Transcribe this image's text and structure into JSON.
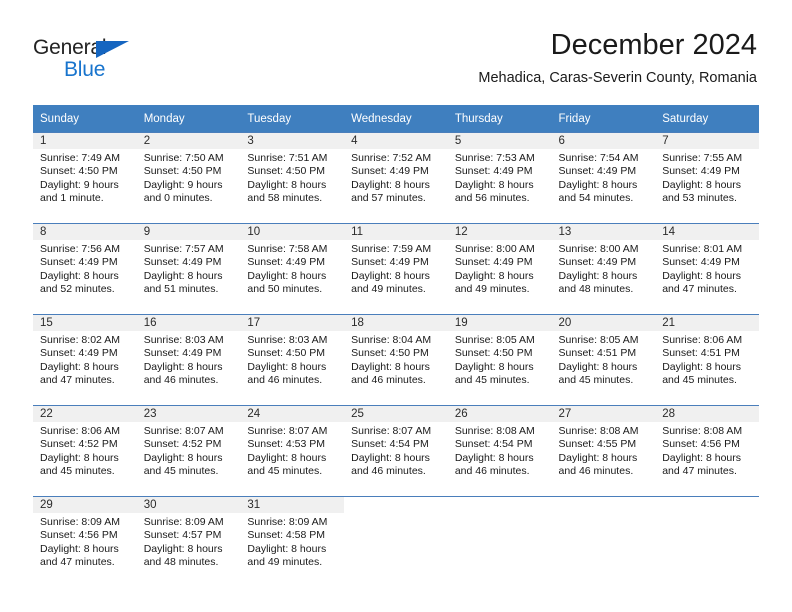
{
  "brand": {
    "name_part1": "General",
    "name_part2": "Blue",
    "accent_color": "#1874cd"
  },
  "header": {
    "title": "December 2024",
    "subtitle": "Mehadica, Caras-Severin County, Romania"
  },
  "calendar": {
    "header_bg": "#3f7fbf",
    "weekdays": [
      "Sunday",
      "Monday",
      "Tuesday",
      "Wednesday",
      "Thursday",
      "Friday",
      "Saturday"
    ],
    "weeks": [
      [
        {
          "day": "1",
          "sunrise": "Sunrise: 7:49 AM",
          "sunset": "Sunset: 4:50 PM",
          "daylight1": "Daylight: 9 hours",
          "daylight2": "and 1 minute."
        },
        {
          "day": "2",
          "sunrise": "Sunrise: 7:50 AM",
          "sunset": "Sunset: 4:50 PM",
          "daylight1": "Daylight: 9 hours",
          "daylight2": "and 0 minutes."
        },
        {
          "day": "3",
          "sunrise": "Sunrise: 7:51 AM",
          "sunset": "Sunset: 4:50 PM",
          "daylight1": "Daylight: 8 hours",
          "daylight2": "and 58 minutes."
        },
        {
          "day": "4",
          "sunrise": "Sunrise: 7:52 AM",
          "sunset": "Sunset: 4:49 PM",
          "daylight1": "Daylight: 8 hours",
          "daylight2": "and 57 minutes."
        },
        {
          "day": "5",
          "sunrise": "Sunrise: 7:53 AM",
          "sunset": "Sunset: 4:49 PM",
          "daylight1": "Daylight: 8 hours",
          "daylight2": "and 56 minutes."
        },
        {
          "day": "6",
          "sunrise": "Sunrise: 7:54 AM",
          "sunset": "Sunset: 4:49 PM",
          "daylight1": "Daylight: 8 hours",
          "daylight2": "and 54 minutes."
        },
        {
          "day": "7",
          "sunrise": "Sunrise: 7:55 AM",
          "sunset": "Sunset: 4:49 PM",
          "daylight1": "Daylight: 8 hours",
          "daylight2": "and 53 minutes."
        }
      ],
      [
        {
          "day": "8",
          "sunrise": "Sunrise: 7:56 AM",
          "sunset": "Sunset: 4:49 PM",
          "daylight1": "Daylight: 8 hours",
          "daylight2": "and 52 minutes."
        },
        {
          "day": "9",
          "sunrise": "Sunrise: 7:57 AM",
          "sunset": "Sunset: 4:49 PM",
          "daylight1": "Daylight: 8 hours",
          "daylight2": "and 51 minutes."
        },
        {
          "day": "10",
          "sunrise": "Sunrise: 7:58 AM",
          "sunset": "Sunset: 4:49 PM",
          "daylight1": "Daylight: 8 hours",
          "daylight2": "and 50 minutes."
        },
        {
          "day": "11",
          "sunrise": "Sunrise: 7:59 AM",
          "sunset": "Sunset: 4:49 PM",
          "daylight1": "Daylight: 8 hours",
          "daylight2": "and 49 minutes."
        },
        {
          "day": "12",
          "sunrise": "Sunrise: 8:00 AM",
          "sunset": "Sunset: 4:49 PM",
          "daylight1": "Daylight: 8 hours",
          "daylight2": "and 49 minutes."
        },
        {
          "day": "13",
          "sunrise": "Sunrise: 8:00 AM",
          "sunset": "Sunset: 4:49 PM",
          "daylight1": "Daylight: 8 hours",
          "daylight2": "and 48 minutes."
        },
        {
          "day": "14",
          "sunrise": "Sunrise: 8:01 AM",
          "sunset": "Sunset: 4:49 PM",
          "daylight1": "Daylight: 8 hours",
          "daylight2": "and 47 minutes."
        }
      ],
      [
        {
          "day": "15",
          "sunrise": "Sunrise: 8:02 AM",
          "sunset": "Sunset: 4:49 PM",
          "daylight1": "Daylight: 8 hours",
          "daylight2": "and 47 minutes."
        },
        {
          "day": "16",
          "sunrise": "Sunrise: 8:03 AM",
          "sunset": "Sunset: 4:49 PM",
          "daylight1": "Daylight: 8 hours",
          "daylight2": "and 46 minutes."
        },
        {
          "day": "17",
          "sunrise": "Sunrise: 8:03 AM",
          "sunset": "Sunset: 4:50 PM",
          "daylight1": "Daylight: 8 hours",
          "daylight2": "and 46 minutes."
        },
        {
          "day": "18",
          "sunrise": "Sunrise: 8:04 AM",
          "sunset": "Sunset: 4:50 PM",
          "daylight1": "Daylight: 8 hours",
          "daylight2": "and 46 minutes."
        },
        {
          "day": "19",
          "sunrise": "Sunrise: 8:05 AM",
          "sunset": "Sunset: 4:50 PM",
          "daylight1": "Daylight: 8 hours",
          "daylight2": "and 45 minutes."
        },
        {
          "day": "20",
          "sunrise": "Sunrise: 8:05 AM",
          "sunset": "Sunset: 4:51 PM",
          "daylight1": "Daylight: 8 hours",
          "daylight2": "and 45 minutes."
        },
        {
          "day": "21",
          "sunrise": "Sunrise: 8:06 AM",
          "sunset": "Sunset: 4:51 PM",
          "daylight1": "Daylight: 8 hours",
          "daylight2": "and 45 minutes."
        }
      ],
      [
        {
          "day": "22",
          "sunrise": "Sunrise: 8:06 AM",
          "sunset": "Sunset: 4:52 PM",
          "daylight1": "Daylight: 8 hours",
          "daylight2": "and 45 minutes."
        },
        {
          "day": "23",
          "sunrise": "Sunrise: 8:07 AM",
          "sunset": "Sunset: 4:52 PM",
          "daylight1": "Daylight: 8 hours",
          "daylight2": "and 45 minutes."
        },
        {
          "day": "24",
          "sunrise": "Sunrise: 8:07 AM",
          "sunset": "Sunset: 4:53 PM",
          "daylight1": "Daylight: 8 hours",
          "daylight2": "and 45 minutes."
        },
        {
          "day": "25",
          "sunrise": "Sunrise: 8:07 AM",
          "sunset": "Sunset: 4:54 PM",
          "daylight1": "Daylight: 8 hours",
          "daylight2": "and 46 minutes."
        },
        {
          "day": "26",
          "sunrise": "Sunrise: 8:08 AM",
          "sunset": "Sunset: 4:54 PM",
          "daylight1": "Daylight: 8 hours",
          "daylight2": "and 46 minutes."
        },
        {
          "day": "27",
          "sunrise": "Sunrise: 8:08 AM",
          "sunset": "Sunset: 4:55 PM",
          "daylight1": "Daylight: 8 hours",
          "daylight2": "and 46 minutes."
        },
        {
          "day": "28",
          "sunrise": "Sunrise: 8:08 AM",
          "sunset": "Sunset: 4:56 PM",
          "daylight1": "Daylight: 8 hours",
          "daylight2": "and 47 minutes."
        }
      ],
      [
        {
          "day": "29",
          "sunrise": "Sunrise: 8:09 AM",
          "sunset": "Sunset: 4:56 PM",
          "daylight1": "Daylight: 8 hours",
          "daylight2": "and 47 minutes."
        },
        {
          "day": "30",
          "sunrise": "Sunrise: 8:09 AM",
          "sunset": "Sunset: 4:57 PM",
          "daylight1": "Daylight: 8 hours",
          "daylight2": "and 48 minutes."
        },
        {
          "day": "31",
          "sunrise": "Sunrise: 8:09 AM",
          "sunset": "Sunset: 4:58 PM",
          "daylight1": "Daylight: 8 hours",
          "daylight2": "and 49 minutes."
        },
        {
          "day": "",
          "sunrise": "",
          "sunset": "",
          "daylight1": "",
          "daylight2": ""
        },
        {
          "day": "",
          "sunrise": "",
          "sunset": "",
          "daylight1": "",
          "daylight2": ""
        },
        {
          "day": "",
          "sunrise": "",
          "sunset": "",
          "daylight1": "",
          "daylight2": ""
        },
        {
          "day": "",
          "sunrise": "",
          "sunset": "",
          "daylight1": "",
          "daylight2": ""
        }
      ]
    ]
  }
}
